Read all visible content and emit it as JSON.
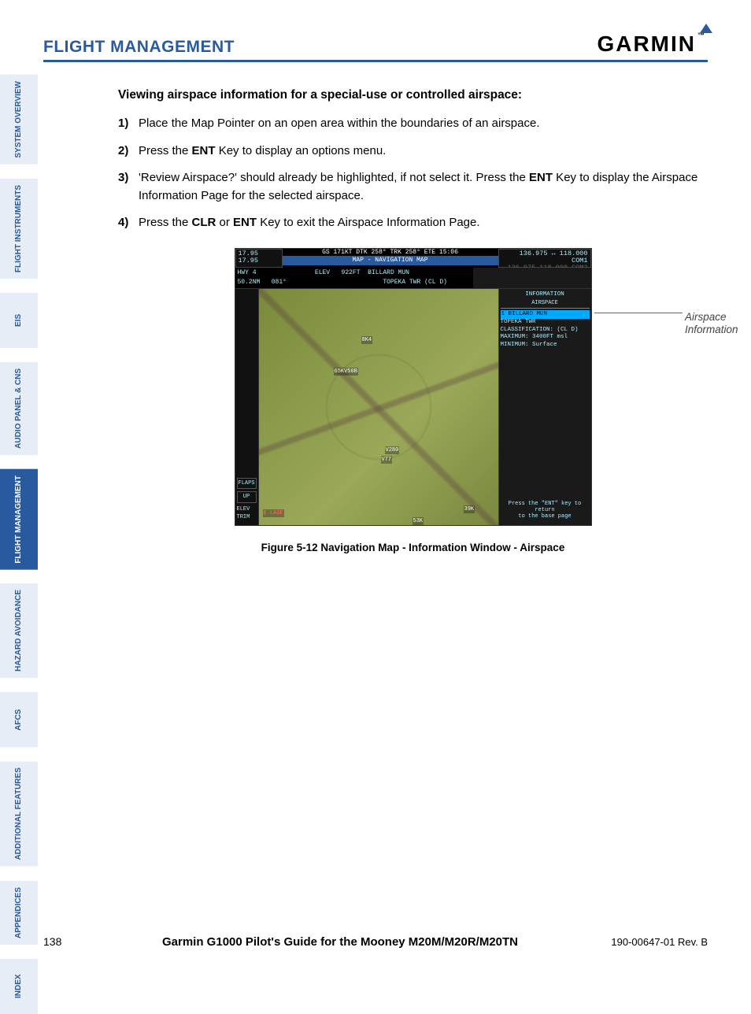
{
  "header": {
    "section_title": "FLIGHT MANAGEMENT",
    "brand": "GARMIN",
    "tm": "™"
  },
  "tabs": [
    {
      "label": "SYSTEM\nOVERVIEW",
      "active": false
    },
    {
      "label": "FLIGHT\nINSTRUMENTS",
      "active": false
    },
    {
      "label": "EIS",
      "active": false
    },
    {
      "label": "AUDIO PANEL\n& CNS",
      "active": false
    },
    {
      "label": "FLIGHT\nMANAGEMENT",
      "active": true
    },
    {
      "label": "HAZARD\nAVOIDANCE",
      "active": false
    },
    {
      "label": "AFCS",
      "active": false
    },
    {
      "label": "ADDITIONAL\nFEATURES",
      "active": false
    },
    {
      "label": "APPENDICES",
      "active": false
    },
    {
      "label": "INDEX",
      "active": false
    }
  ],
  "body": {
    "subheading": "Viewing airspace information for a special-use or controlled airspace:",
    "steps": [
      {
        "n": "1)",
        "pre": "Place the Map Pointer on an open area within the boundaries of an airspace."
      },
      {
        "n": "2)",
        "pre": "Press the ",
        "key1": "ENT",
        "post1": " Key to display an options menu."
      },
      {
        "n": "3)",
        "pre": "'Review Airspace?' should already be highlighted, if not select it.  Press the ",
        "key1": "ENT",
        "post1": " Key to display the Airspace Information Page for the selected airspace."
      },
      {
        "n": "4)",
        "pre": "Press the ",
        "key1": "CLR",
        "mid": " or ",
        "key2": "ENT",
        "post2": " Key to exit the Airspace Information Page."
      }
    ]
  },
  "figure": {
    "nav1": "17.95",
    "nav2": "17.95",
    "top_status": "GS  171KT    DTK 258°     TRK 258°      ETE 15:06",
    "page_title": "MAP - NAVIGATION MAP",
    "com_row1": "136.975 ↔ 118.000 COM1",
    "com_row2": "136.975     118.000 COM2",
    "wpt": {
      "id": "HWY 4",
      "dist": "50.2NM",
      "brg": "081°",
      "elev_lbl": "ELEV",
      "elev": "922FT",
      "name1": "BILLARD MUN",
      "name2": "TOPEKA TWR (CL D)"
    },
    "info": {
      "title": "INFORMATION",
      "sub": "AIRSPACE",
      "hl": "1 BILLARD MUN",
      "l1": "TOPEKA TWR",
      "l2": "CLASSIFICATION: (CL D)",
      "l3": "MAXIMUM: 3400FT msl",
      "l4": "MINIMUM: Surface",
      "footer1": "Press the \"ENT\" key to return",
      "footer2": "to the base page"
    },
    "flaps_lbl": "FLAPS",
    "flaps_val": "UP",
    "trim_lbl": "ELEV\nTRIM",
    "map_labels": {
      "a": "8K4",
      "b": "65KV50B",
      "c": "V280",
      "d": "V77",
      "e": "39K",
      "f": "53K",
      "g": "E LASE"
    },
    "callout": "Airspace Information",
    "caption": "Figure 5-12  Navigation Map - Information Window - Airspace"
  },
  "footer": {
    "page": "138",
    "title": "Garmin G1000 Pilot's Guide for the Mooney M20M/M20R/M20TN",
    "rev": "190-00647-01  Rev. B"
  }
}
